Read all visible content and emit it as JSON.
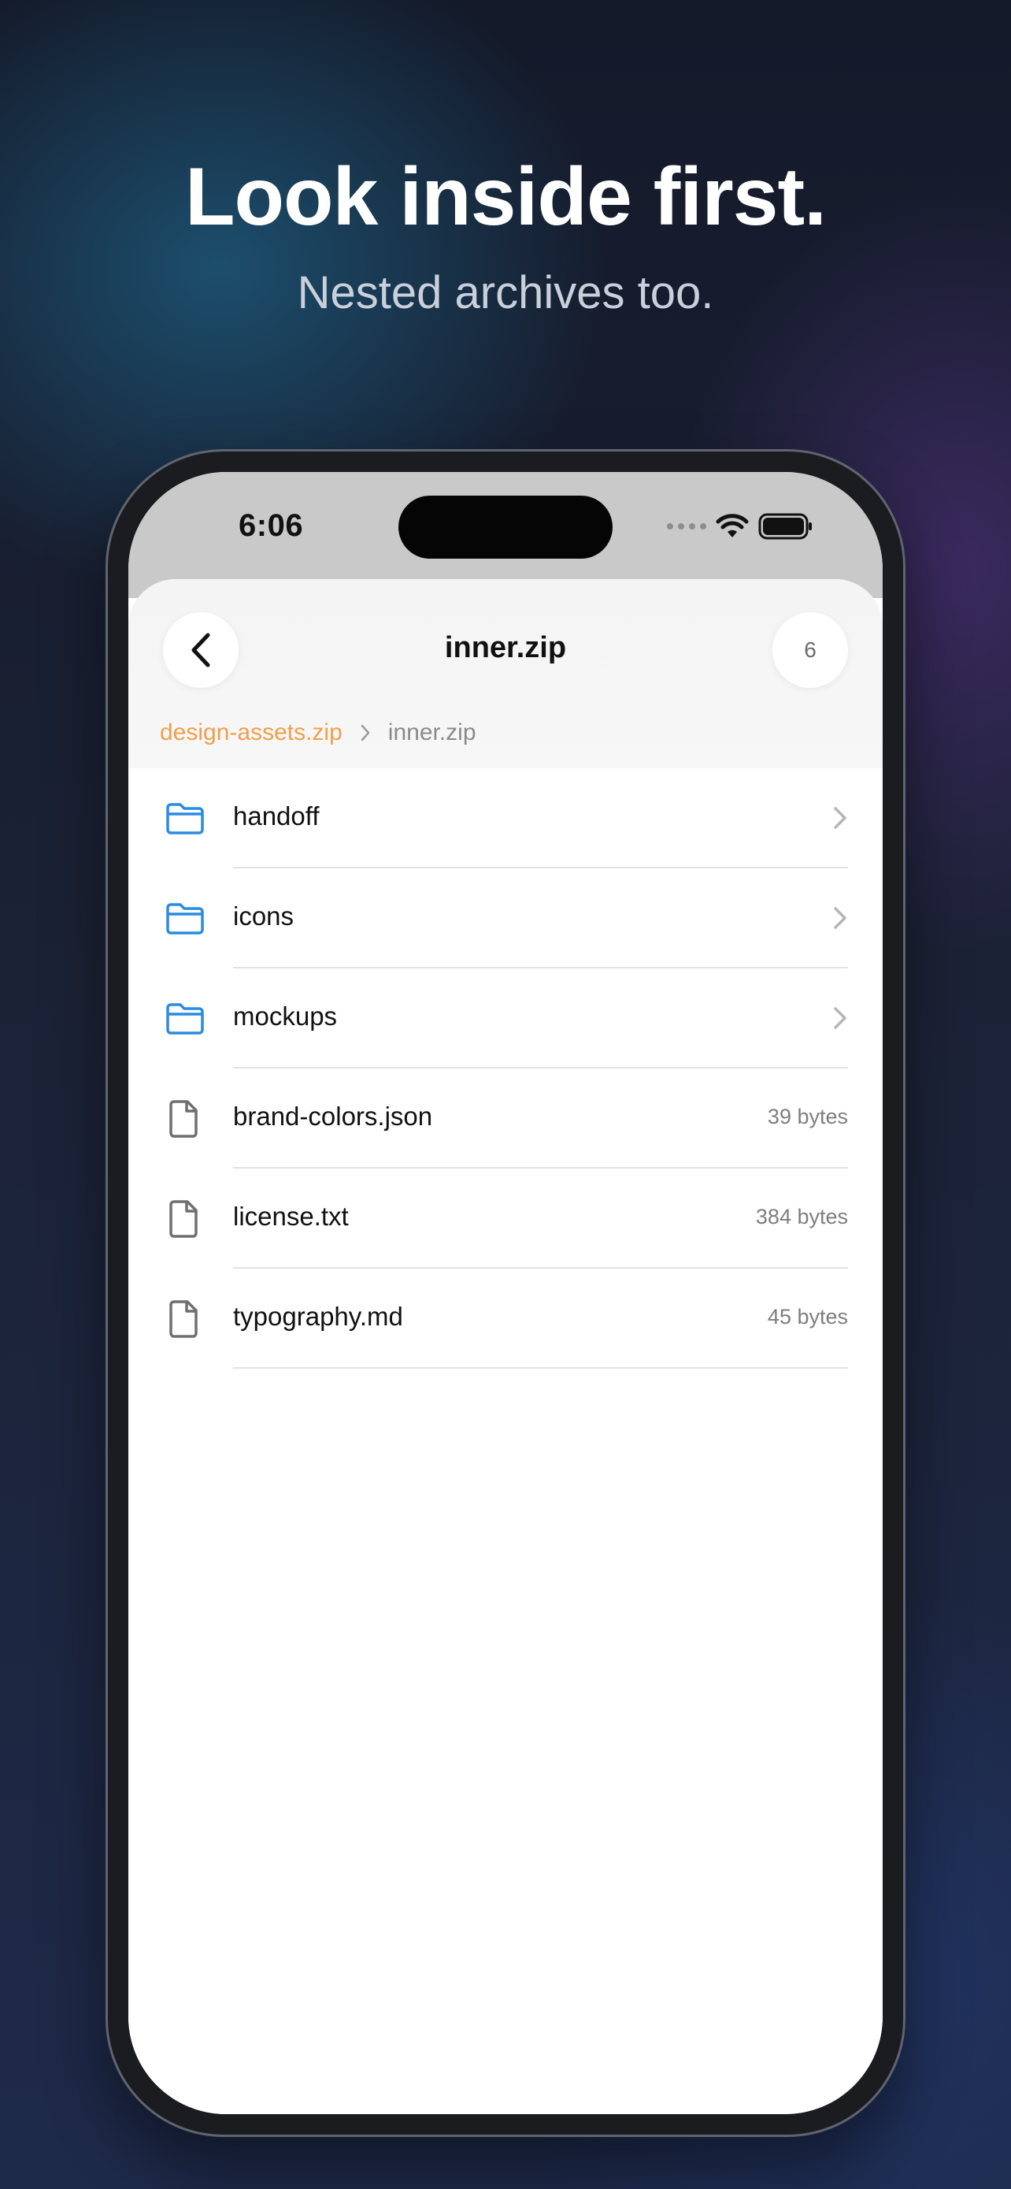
{
  "promo": {
    "headline": "Look inside first.",
    "subhead": "Nested archives too."
  },
  "status_bar": {
    "time": "6:06"
  },
  "navbar": {
    "title": "inner.zip",
    "count": "6"
  },
  "breadcrumb": {
    "root": "design-assets.zip",
    "current": "inner.zip"
  },
  "entries": [
    {
      "name": "handoff",
      "type": "folder"
    },
    {
      "name": "icons",
      "type": "folder"
    },
    {
      "name": "mockups",
      "type": "folder"
    },
    {
      "name": "brand-colors.json",
      "type": "file",
      "size": "39 bytes"
    },
    {
      "name": "license.txt",
      "type": "file",
      "size": "384 bytes"
    },
    {
      "name": "typography.md",
      "type": "file",
      "size": "45 bytes"
    }
  ],
  "colors": {
    "accent_orange": "#f0a04b",
    "folder_blue": "#2a8be0"
  },
  "icons": {
    "back": "chevron-left-icon",
    "folder": "folder-icon",
    "file": "document-icon",
    "disclosure": "chevron-right-icon",
    "wifi": "wifi-icon",
    "battery": "battery-icon"
  }
}
